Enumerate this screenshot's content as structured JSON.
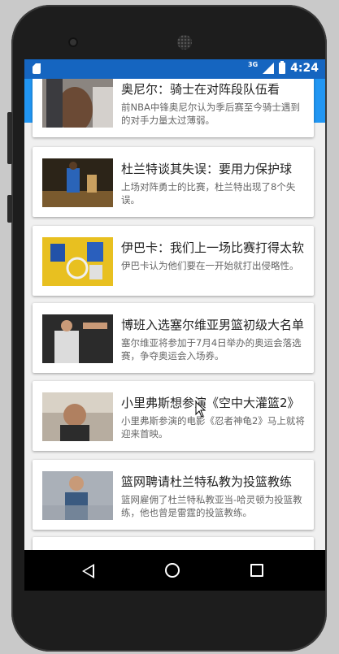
{
  "status_bar": {
    "network": "3G",
    "time": "4:24"
  },
  "news": [
    {
      "title": "奥尼尔：骑士在对阵段队伍看",
      "desc": "前NBA中锋奥尼尔认为季后赛至今骑士遇到的对手力量太过薄弱。"
    },
    {
      "title": "杜兰特谈其失误：要用力保护球",
      "desc": "上场对阵勇士的比赛，杜兰特出现了8个失误。"
    },
    {
      "title": "伊巴卡：我们上一场比赛打得太软",
      "desc": "伊巴卡认为他们要在一开始就打出侵略性。"
    },
    {
      "title": "博班入选塞尔维亚男篮初级大名单",
      "desc": "塞尔维亚将参加于7月4日举办的奥运会落选赛，争夺奥运会入场券。"
    },
    {
      "title": "小里弗斯想参演《空中大灌篮2》",
      "desc": "小里弗斯参演的电影《忍者神龟2》马上就将迎来首映。"
    },
    {
      "title": "篮网聘请杜兰特私教为投篮教练",
      "desc": "篮网雇佣了杜兰特私教亚当-哈灵顿为投篮教练，他也曾是雷霆的投篮教练。"
    }
  ],
  "colors": {
    "status_bar": "#1565c0",
    "app_bar": "#2196f3"
  }
}
